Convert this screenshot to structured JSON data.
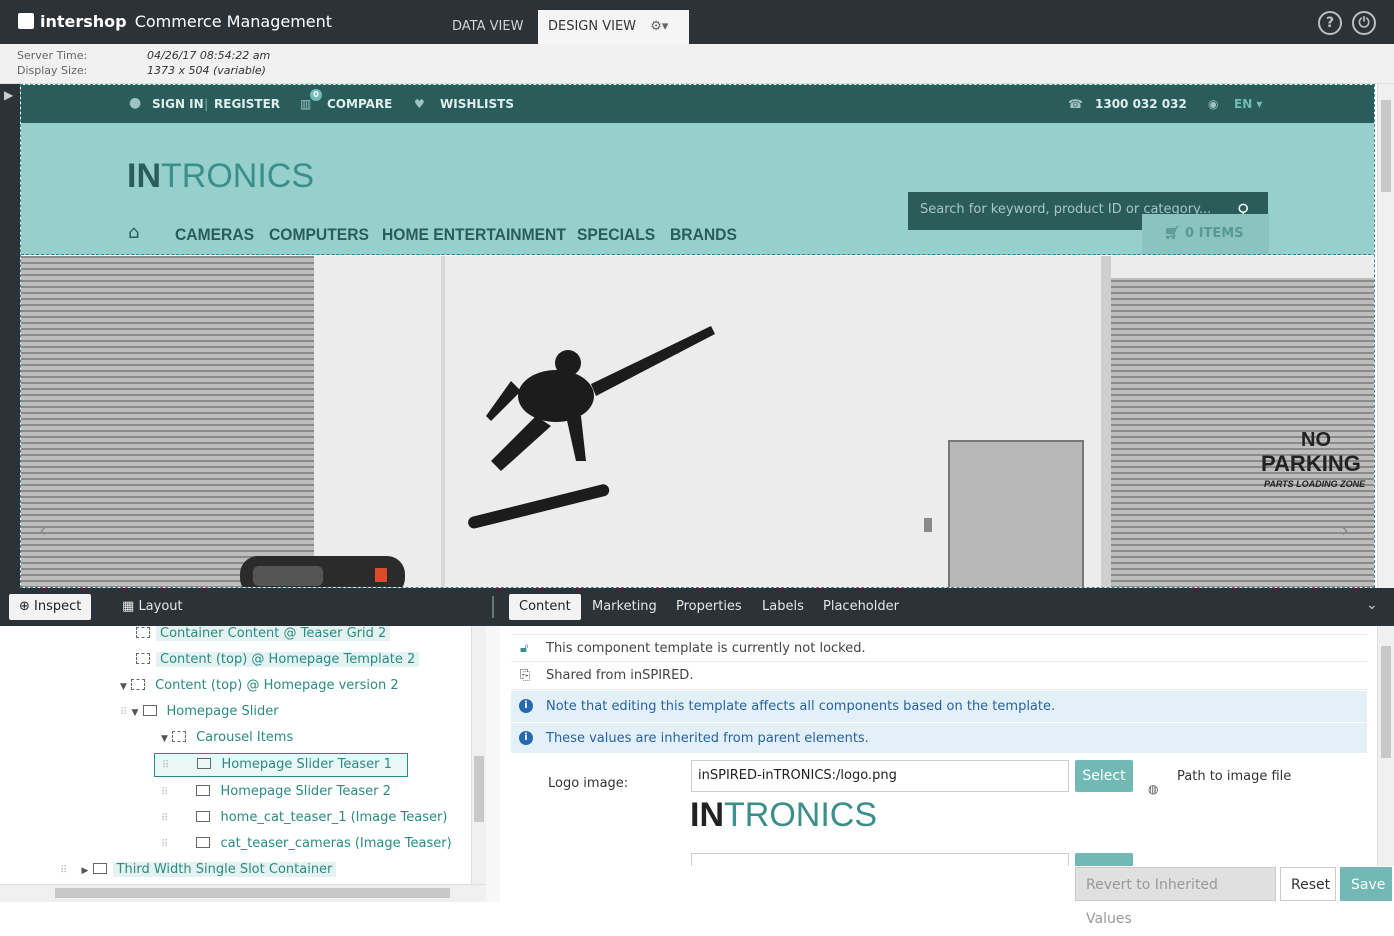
{
  "app": {
    "brand_bold": "intershop",
    "brand_rest": "Commerce Management",
    "tabs": [
      "DATA VIEW",
      "DESIGN VIEW"
    ],
    "help_icon": "?",
    "power_icon": "⏻"
  },
  "server": {
    "time_label": "Server Time:",
    "time_value": "04/26/17 08:54:22 am",
    "size_label": "Display Size:",
    "size_value": "1373 x 504 (variable)"
  },
  "preview": {
    "topbar": {
      "sign_in": "SIGN IN",
      "register": "REGISTER",
      "compare": "COMPARE",
      "compare_count": "0",
      "wishlists": "WISHLISTS",
      "phone": "1300 032 032",
      "lang": "EN"
    },
    "logo_bold": "IN",
    "logo_light": "TRONICS",
    "search_placeholder": "Search for keyword, product ID or category...",
    "nav": [
      "CAMERAS",
      "COMPUTERS",
      "HOME ENTERTAINMENT",
      "SPECIALS",
      "BRANDS"
    ],
    "cart": "0 ITEMS",
    "hero_sign_1": "NO",
    "hero_sign_2": "PARKING",
    "hero_sign_3": "PARTS LOADING ZONE"
  },
  "bottom_toolbar": {
    "inspect": "Inspect",
    "layout": "Layout",
    "tabs": [
      "Content",
      "Marketing",
      "Properties",
      "Labels",
      "Placeholder"
    ]
  },
  "tree": [
    {
      "label": "Container Content @ Teaser Grid 2"
    },
    {
      "label": "Content (top) @ Homepage Template 2"
    },
    {
      "label": "Content (top) @ Homepage version 2"
    },
    {
      "label": "Homepage Slider"
    },
    {
      "label": "Carousel Items"
    },
    {
      "label": "Homepage Slider Teaser 1"
    },
    {
      "label": "Homepage Slider Teaser 2"
    },
    {
      "label": "home_cat_teaser_1 (Image Teaser)"
    },
    {
      "label": "cat_teaser_cameras (Image Teaser)"
    },
    {
      "label": "Third Width Single Slot Container"
    }
  ],
  "panel": {
    "lock_msg": "This component template is currently not locked.",
    "shared_msg": "Shared from inSPIRED.",
    "note_msg": "Note that editing this template affects all components based on the template.",
    "inherit_msg": "These values are inherited from parent elements.",
    "logo_label": "Logo image:",
    "logo_value": "inSPIRED-inTRONICS:/logo.png",
    "select_label": "Select",
    "path_hint": "Path to image file"
  },
  "footer": {
    "revert": "Revert to Inherited Values",
    "reset": "Reset",
    "save": "Save"
  },
  "colors": {
    "accent": "#72b9b5",
    "dark": "#2c3338",
    "shop_dark": "#2a5d5a",
    "shop_light": "#96cfcb"
  }
}
